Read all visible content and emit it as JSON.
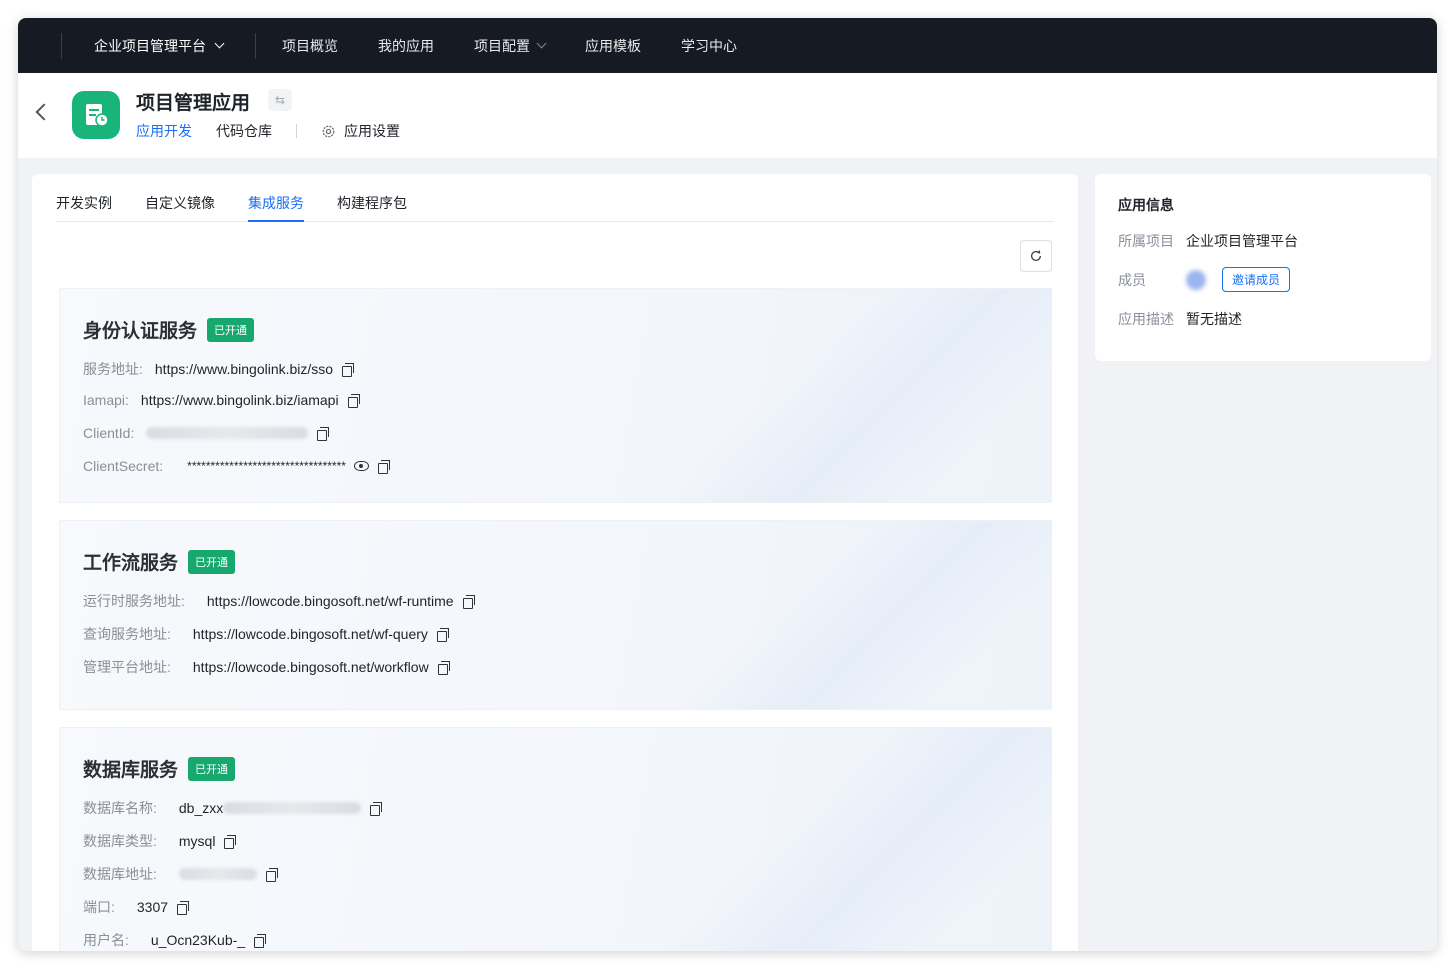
{
  "topbar": {
    "platform": "企业项目管理平台",
    "nav": [
      {
        "label": "项目概览",
        "dropdown": false
      },
      {
        "label": "我的应用",
        "dropdown": false
      },
      {
        "label": "项目配置",
        "dropdown": true
      },
      {
        "label": "应用模板",
        "dropdown": false
      },
      {
        "label": "学习中心",
        "dropdown": false
      }
    ]
  },
  "app": {
    "title": "项目管理应用",
    "switch_icon": "⇆",
    "tabs": [
      "应用开发",
      "代码仓库"
    ],
    "settings_label": "应用设置"
  },
  "main": {
    "tabs": [
      "开发实例",
      "自定义镜像",
      "集成服务",
      "构建程序包"
    ],
    "active_tab": "集成服务"
  },
  "services": [
    {
      "title": "身份认证服务",
      "badge": "已开通",
      "rows": [
        {
          "label": "服务地址:",
          "value": "https://www.bingolink.biz/sso"
        },
        {
          "label": "Iamapi:",
          "value": "https://www.bingolink.biz/iamapi"
        },
        {
          "label": "ClientId:",
          "value": ""
        },
        {
          "label": "ClientSecret:",
          "value": "**********************************"
        }
      ]
    },
    {
      "title": "工作流服务",
      "badge": "已开通",
      "rows": [
        {
          "label": "运行时服务地址:",
          "value": "https://lowcode.bingosoft.net/wf-runtime"
        },
        {
          "label": "查询服务地址:",
          "value": "https://lowcode.bingosoft.net/wf-query"
        },
        {
          "label": "管理平台地址:",
          "value": "https://lowcode.bingosoft.net/workflow"
        }
      ]
    },
    {
      "title": "数据库服务",
      "badge": "已开通",
      "rows": [
        {
          "label": "数据库名称:",
          "value": "db_zxx"
        },
        {
          "label": "数据库类型:",
          "value": "mysql"
        },
        {
          "label": "数据库地址:",
          "value": ""
        },
        {
          "label": "端口:",
          "value": "3307"
        },
        {
          "label": "用户名:",
          "value": "u_Ocn23Kub-_"
        }
      ]
    }
  ],
  "side": {
    "title": "应用信息",
    "project_label": "所属项目",
    "project_value": "企业项目管理平台",
    "members_label": "成员",
    "invite_label": "邀请成员",
    "desc_label": "应用描述",
    "desc_value": "暂无描述"
  },
  "colors": {
    "primary": "#1a6ff5",
    "success": "#16a86d",
    "topbar": "#161a23",
    "app_icon": "#19b47a"
  }
}
